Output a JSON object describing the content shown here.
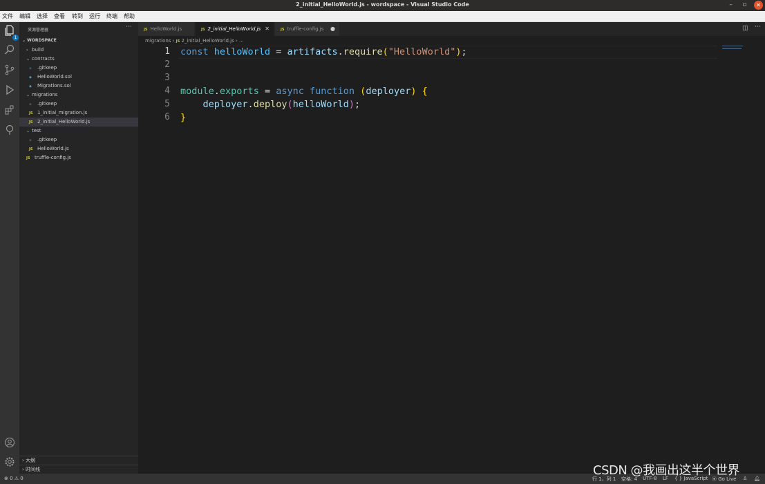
{
  "window": {
    "title": "2_initial_HelloWorld.js - wordspace - Visual Studio Code"
  },
  "menu": [
    "文件",
    "编辑",
    "选择",
    "查看",
    "转到",
    "运行",
    "终端",
    "帮助"
  ],
  "activity_bar": {
    "explorer_badge": "1",
    "icons": [
      "files-icon",
      "search-icon",
      "source-control-icon",
      "run-debug-icon",
      "extensions-icon",
      "remote-tree-icon"
    ],
    "bottom_icons": [
      "account-icon",
      "settings-gear-icon"
    ]
  },
  "sidebar": {
    "title": "资源管理器",
    "more": "···",
    "workspace": "WORDSPACE",
    "tree": [
      {
        "label": "build",
        "type": "folder",
        "expanded": false,
        "depth": 0
      },
      {
        "label": "contracts",
        "type": "folder",
        "expanded": true,
        "depth": 0
      },
      {
        "label": ".gitkeep",
        "type": "git",
        "depth": 1
      },
      {
        "label": "HelloWorld.sol",
        "type": "sol",
        "depth": 1
      },
      {
        "label": "Migrations.sol",
        "type": "sol",
        "depth": 1
      },
      {
        "label": "migrations",
        "type": "folder",
        "expanded": true,
        "depth": 0
      },
      {
        "label": ".gitkeep",
        "type": "git",
        "depth": 1
      },
      {
        "label": "1_initial_migration.js",
        "type": "js",
        "depth": 1
      },
      {
        "label": "2_initial_HelloWorld.js",
        "type": "js",
        "depth": 1,
        "selected": true
      },
      {
        "label": "test",
        "type": "folder",
        "expanded": true,
        "depth": 0
      },
      {
        "label": ".gitkeep",
        "type": "git",
        "depth": 1
      },
      {
        "label": "HelloWorld.js",
        "type": "js",
        "depth": 1
      },
      {
        "label": "truffle-config.js",
        "type": "js",
        "depth": 0
      }
    ],
    "outline_label": "大纲",
    "timeline_label": "时间线"
  },
  "tabs": [
    {
      "label": "HelloWorld.js",
      "active": false,
      "modified": false
    },
    {
      "label": "2_initial_HelloWorld.js",
      "active": true,
      "modified": false
    },
    {
      "label": "truffle-config.js",
      "active": false,
      "modified": true
    }
  ],
  "file_icon_text": "JS",
  "breadcrumb": {
    "folder": "migrations",
    "file": "2_initial_HelloWorld.js",
    "tail": "..."
  },
  "editor": {
    "line_numbers": [
      "1",
      "2",
      "3",
      "4",
      "5",
      "6"
    ],
    "code": {
      "l1": {
        "kw": "const",
        "var": "helloWorld",
        "eq": " = ",
        "obj": "artifacts",
        "dot": ".",
        "fn": "require",
        "open": "(",
        "str": "\"HelloWorld\"",
        "close": ")",
        "semi": ";"
      },
      "l4": {
        "obj": "module",
        "dot": ".",
        "prop": "exports",
        "eq": " = ",
        "kw1": "async",
        "kw2": "function",
        "open": "(",
        "param": "deployer",
        "close": ")",
        "brace": "{"
      },
      "l5": {
        "obj": "deployer",
        "dot": ".",
        "fn": "deploy",
        "open": "(",
        "arg": "helloWorld",
        "close": ")",
        "semi": ";"
      },
      "l6": {
        "brace": "}"
      }
    }
  },
  "statusbar": {
    "problems": "⊗ 0 ⚠ 0",
    "position": "行 1，列 1",
    "spaces": "空格: 4",
    "encoding": "UTF-8",
    "eol": "LF",
    "language": "{ } JavaScript",
    "golive": "⦿ Go Live"
  },
  "watermark": "CSDN @我画出这半个世界"
}
